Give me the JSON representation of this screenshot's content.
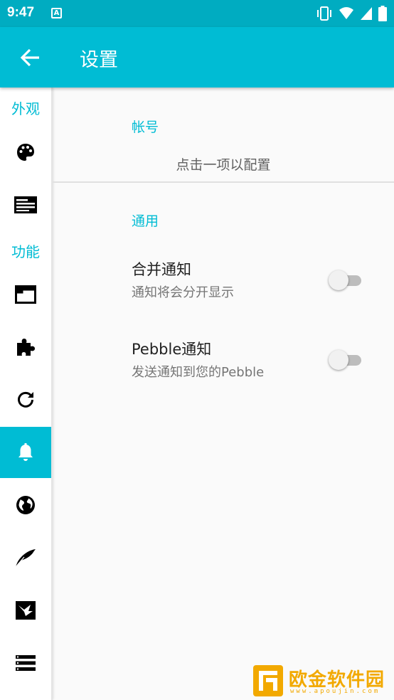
{
  "status_bar": {
    "time": "9:47",
    "notification_glyph": "A",
    "icons": [
      "vibrate-icon",
      "wifi-icon",
      "signal-icon",
      "battery-icon"
    ]
  },
  "toolbar": {
    "title": "设置",
    "back_icon": "arrow-back-icon"
  },
  "sidebar": {
    "sections": [
      {
        "header": "外观",
        "items": [
          {
            "icon": "palette-icon",
            "active": false
          },
          {
            "icon": "web-layout-icon",
            "active": false
          }
        ]
      },
      {
        "header": "功能",
        "items": [
          {
            "icon": "window-icon",
            "active": false
          },
          {
            "icon": "puzzle-icon",
            "active": false
          },
          {
            "icon": "refresh-icon",
            "active": false
          },
          {
            "icon": "bell-icon",
            "active": true
          },
          {
            "icon": "globe-icon",
            "active": false
          },
          {
            "icon": "quill-icon",
            "active": false
          },
          {
            "icon": "bird-icon",
            "active": false
          },
          {
            "icon": "storage-icon",
            "active": false
          }
        ]
      }
    ]
  },
  "main": {
    "account": {
      "title": "帐号",
      "hint": "点击一项以配置"
    },
    "general": {
      "title": "通用",
      "prefs": [
        {
          "title": "合并通知",
          "summary": "通知将会分开显示",
          "checked": false
        },
        {
          "title": "Pebble通知",
          "summary": "发送通知到您的Pebble",
          "checked": false
        }
      ]
    }
  },
  "watermark": {
    "title": "欧金软件园",
    "url": "www.apoujin.com"
  },
  "colors": {
    "accent": "#00bcd4",
    "status_bar": "#00acc1",
    "text_primary": "#212121",
    "text_secondary": "#757575"
  }
}
